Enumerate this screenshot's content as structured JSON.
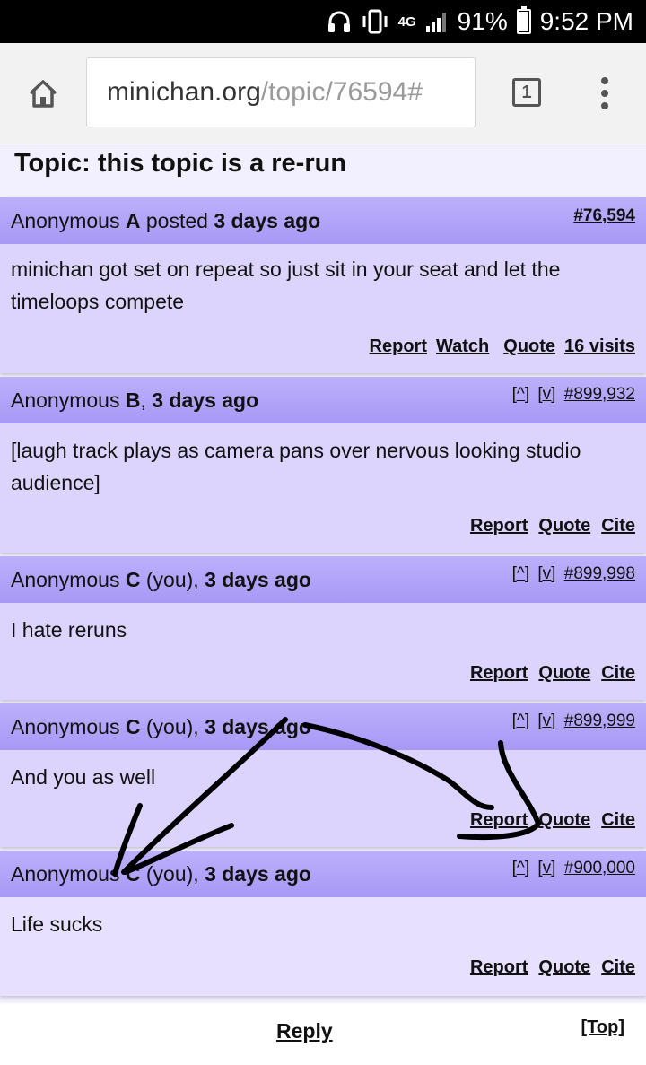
{
  "status_bar": {
    "network": "4G",
    "battery_percent": "91%",
    "time": "9:52 PM",
    "battery_level": 0.91
  },
  "browser": {
    "url_host": "minichan.org",
    "url_path": "/topic/76594#",
    "tab_count": "1"
  },
  "page": {
    "title": "Topic: this topic is a re-run"
  },
  "posts": [
    {
      "anon_prefix": "Anonymous ",
      "letter": "A",
      "suffix": " posted ",
      "time": "3 days ago",
      "number": "#76,594",
      "body": "minichan got set on repeat so just sit in your seat and let the timeloops compete",
      "actions": [
        "Report",
        "Watch",
        "Quote",
        "16 visits"
      ]
    },
    {
      "anon_prefix": "Anonymous ",
      "letter": "B",
      "suffix": ", ",
      "time": "3 days ago",
      "up": "[^]",
      "down": "[v]",
      "number": "#899,932",
      "body": "[laugh track plays as camera pans over nervous looking studio audience]",
      "actions": [
        "Report",
        "Quote",
        "Cite"
      ]
    },
    {
      "anon_prefix": "Anonymous ",
      "letter": "C",
      "suffix": " (you), ",
      "time": "3 days ago",
      "up": "[^]",
      "down": "[v]",
      "number": "#899,998",
      "body": "I hate reruns",
      "actions": [
        "Report",
        "Quote",
        "Cite"
      ]
    },
    {
      "anon_prefix": "Anonymous ",
      "letter": "C",
      "suffix": " (you), ",
      "time": "3 days ago",
      "up": "[^]",
      "down": "[v]",
      "number": "#899,999",
      "body": "And you as well",
      "actions": [
        "Report",
        "Quote",
        "Cite"
      ]
    },
    {
      "anon_prefix": "Anonymous ",
      "letter": "C",
      "suffix": " (you), ",
      "time": "3 days ago",
      "up": "[^]",
      "down": "[v]",
      "number": "#900,000",
      "body": "Life sucks",
      "actions": [
        "Report",
        "Quote",
        "Cite"
      ]
    }
  ],
  "footer": {
    "reply": "Reply",
    "top": "[Top]"
  }
}
